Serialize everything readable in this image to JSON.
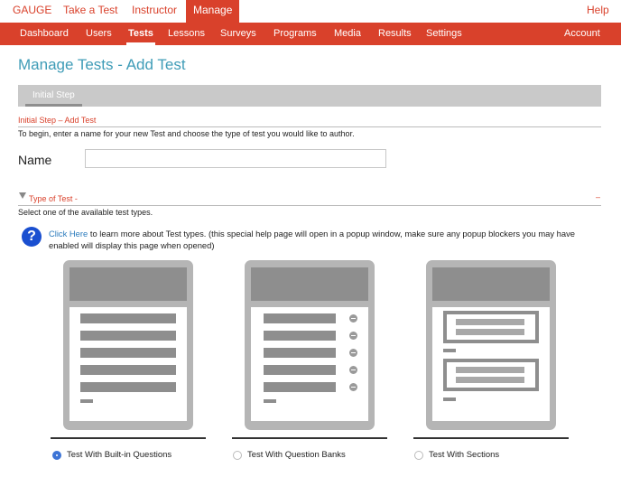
{
  "top_nav": {
    "gauge": "GAUGE",
    "take_a_test": "Take a Test",
    "instructor": "Instructor",
    "manage": "Manage",
    "help": "Help"
  },
  "sub_nav": [
    "Dashboard",
    "Users",
    "Tests",
    "Lessons",
    "Surveys",
    "Programs",
    "Media",
    "Results",
    "Settings",
    "Account"
  ],
  "page_title": "Manage Tests - Add Test",
  "step_tab": "Initial Step",
  "initial_section": {
    "title": "Initial Step – Add Test",
    "description": "To begin, enter a name for your new Test and choose the type of test you would like to author."
  },
  "name_field": {
    "label": "Name",
    "value": "",
    "placeholder": ""
  },
  "type_section": {
    "title": "Type of Test -",
    "collapse": "–",
    "description": "Select one of the available test types."
  },
  "help": {
    "link": "Click Here",
    "text": " to learn more about Test types. (this special help page will open in a popup window, make sure any popup blockers you may have enabled will display this page when opened)"
  },
  "test_types": [
    {
      "label": "Test With Built-in Questions",
      "selected": true
    },
    {
      "label": "Test With Question Banks",
      "selected": false
    },
    {
      "label": "Test With Sections",
      "selected": false
    }
  ],
  "colors": {
    "brand_red": "#d9412b",
    "title_teal": "#3f9cb7",
    "help_blue": "#1a4fd0",
    "radio_blue": "#3d74d6"
  }
}
